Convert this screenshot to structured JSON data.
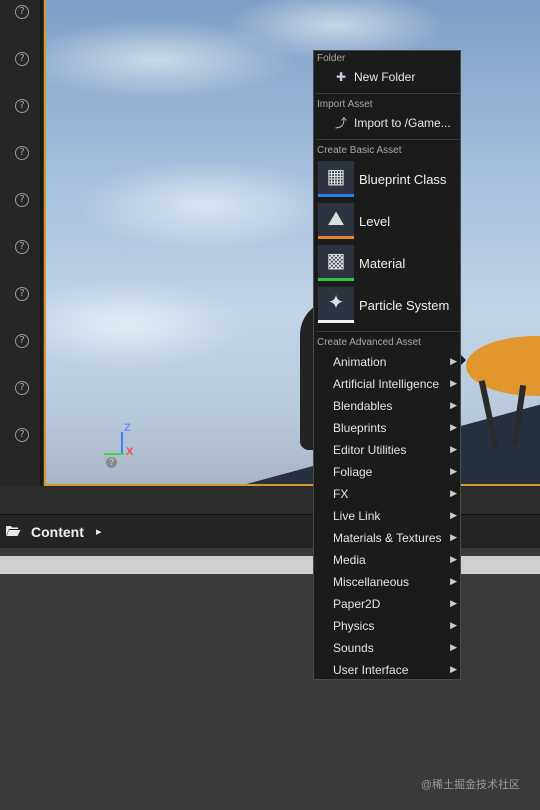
{
  "left_toolbar": {
    "help_icon_glyph": "?",
    "help_icon_count": 10
  },
  "viewport": {
    "axis": {
      "z_label": "Z",
      "x_label": "X",
      "hint_glyph": "?"
    },
    "colors": {
      "sky_top": "#7e9fc6",
      "frame_accent": "#d79a2a",
      "bowl": "#e2972e"
    }
  },
  "content_browser": {
    "icon": "folder-open-icon",
    "title": "Content",
    "arrow": "▸"
  },
  "context_menu": {
    "folder_section": {
      "header": "Folder",
      "items": [
        {
          "label": "New Folder",
          "icon": "new-folder-icon",
          "glyph": "✚"
        }
      ]
    },
    "import_section": {
      "header": "Import Asset",
      "items": [
        {
          "label": "Import to /Game...",
          "icon": "import-icon",
          "glyph": "⤴"
        }
      ]
    },
    "basic_section": {
      "header": "Create Basic Asset",
      "items": [
        {
          "label": "Blueprint Class",
          "icon": "blueprint-class-icon",
          "glyph": "▦",
          "bar_color": "#2f7de1"
        },
        {
          "label": "Level",
          "icon": "level-icon",
          "glyph": "⛰",
          "bar_color": "#e08a2c"
        },
        {
          "label": "Material",
          "icon": "material-icon",
          "glyph": "▩",
          "bar_color": "#35c04a"
        },
        {
          "label": "Particle System",
          "icon": "particle-system-icon",
          "glyph": "✦",
          "bar_color": "#f0f0f0"
        }
      ]
    },
    "advanced_section": {
      "header": "Create Advanced Asset",
      "submenu_arrow": "▶",
      "items": [
        "Animation",
        "Artificial Intelligence",
        "Blendables",
        "Blueprints",
        "Editor Utilities",
        "Foliage",
        "FX",
        "Live Link",
        "Materials & Textures",
        "Media",
        "Miscellaneous",
        "Paper2D",
        "Physics",
        "Sounds",
        "User Interface"
      ]
    }
  },
  "watermark": "@稀土掘金技术社区"
}
